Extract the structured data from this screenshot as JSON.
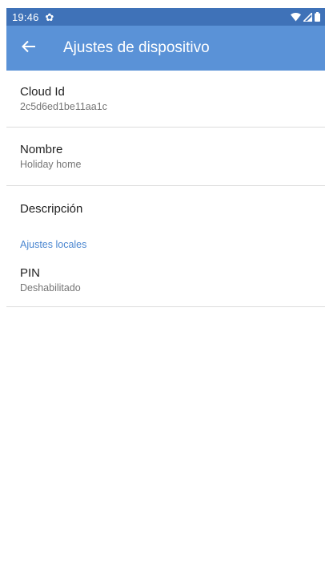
{
  "status_bar": {
    "time": "19:46",
    "icons": [
      "gear-icon",
      "wifi-icon",
      "signal-icon",
      "battery-icon"
    ]
  },
  "app_bar": {
    "title": "Ajustes de dispositivo",
    "back_icon": "arrow-back-icon"
  },
  "colors": {
    "status_bar": "#3f72b8",
    "app_bar": "#5a92d7",
    "section_header": "#4a86d0"
  },
  "preferences": {
    "cloud_id": {
      "title": "Cloud Id",
      "summary": "2c5d6ed1be11aa1c"
    },
    "name": {
      "title": "Nombre",
      "summary": "Holiday home"
    },
    "description": {
      "title": "Descripción"
    },
    "local_section": {
      "title": "Ajustes locales"
    },
    "pin": {
      "title": "PIN",
      "summary": "Deshabilitado"
    }
  }
}
